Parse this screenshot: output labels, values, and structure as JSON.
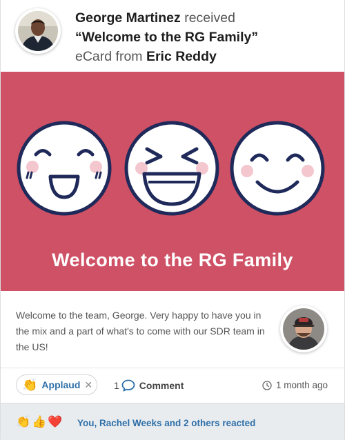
{
  "header": {
    "recipient": "George Martinez",
    "verb": "received",
    "card_title": "“Welcome to the RG Family”",
    "prefix": "eCard from",
    "sender": "Eric Reddy"
  },
  "banner": {
    "title": "Welcome to the RG Family",
    "background": "#cf5165"
  },
  "message": {
    "text": "Welcome to the team, George. Very happy to have you in the mix and a part of what's to come with our SDR team in the US!"
  },
  "actions": {
    "applaud_emoji": "👏",
    "applaud_label": "Applaud",
    "applaud_remove": "✕",
    "comment_count": "1",
    "comment_label": "Comment",
    "time_ago": "1 month ago"
  },
  "footer": {
    "reaction_emojis": "👏👍❤️",
    "reacted_text": "You, Rachel Weeks and 2 others reacted"
  },
  "colors": {
    "accent": "#2e6fa8",
    "banner": "#cf5165",
    "face_outline": "#1f2a5a"
  }
}
